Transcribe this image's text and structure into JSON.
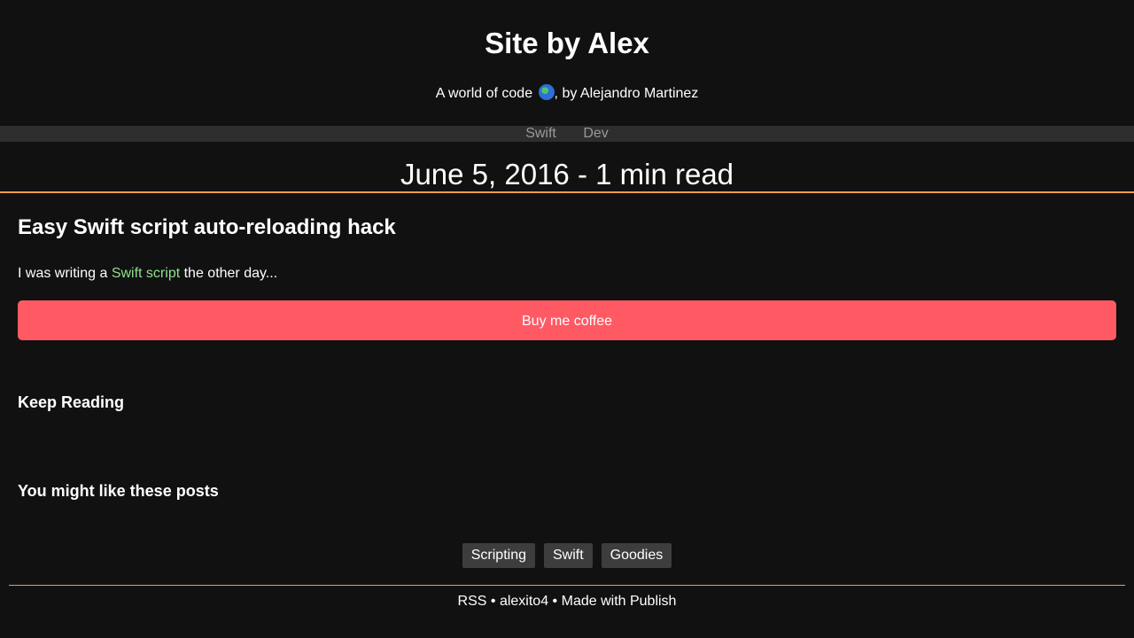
{
  "site": {
    "title": "Site by Alex",
    "subtitle_prefix": "A world of code ",
    "subtitle_icon": "globe-icon",
    "subtitle_suffix": ", by Alejandro Martinez"
  },
  "nav": {
    "items": [
      {
        "label": "Swift"
      },
      {
        "label": "Dev"
      }
    ]
  },
  "post": {
    "meta": "June 5, 2016 - 1 min read",
    "title": "Easy Swift script auto-reloading hack",
    "excerpt_prefix": "I was writing a ",
    "excerpt_link": "Swift script",
    "excerpt_suffix": " the other day...",
    "coffee_button": "Buy me coffee"
  },
  "sections": {
    "keep_reading": "Keep Reading",
    "might_like": "You might like these posts"
  },
  "tags": [
    {
      "label": "Scripting"
    },
    {
      "label": "Swift"
    },
    {
      "label": "Goodies"
    }
  ],
  "footer": {
    "rss": "RSS",
    "sep1": " • ",
    "handle": "alexito4",
    "sep2": " • ",
    "made_with": "Made with Publish"
  },
  "colors": {
    "background": "#111111",
    "accent_line": "#f39b4b",
    "button": "#ff5a64",
    "link": "#8fe08f",
    "nav_bar": "#2e2e2e",
    "tag_bg": "#3d3d3d"
  }
}
